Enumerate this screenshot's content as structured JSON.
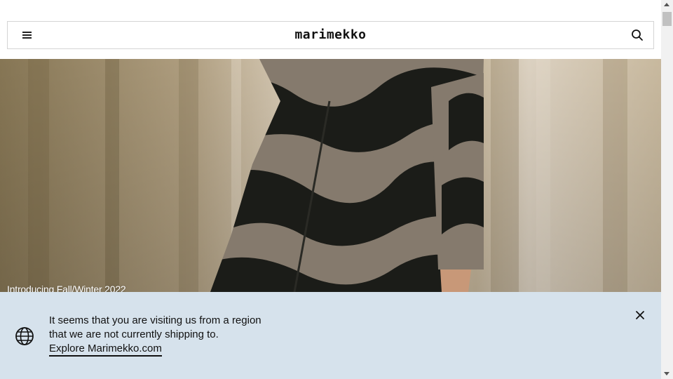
{
  "header": {
    "logo": "marimekko",
    "menu_icon": "hamburger-menu-icon",
    "search_icon": "search-icon"
  },
  "hero": {
    "caption": "Introducing Fall/Winter 2022"
  },
  "region_banner": {
    "message_line1": "It seems that you are visiting us from a region",
    "message_line2": "that we are not currently shipping to.",
    "link_label": "Explore Marimekko.com",
    "background_color": "#d6e2ec",
    "globe_icon": "globe-icon",
    "close_icon": "close-icon"
  }
}
